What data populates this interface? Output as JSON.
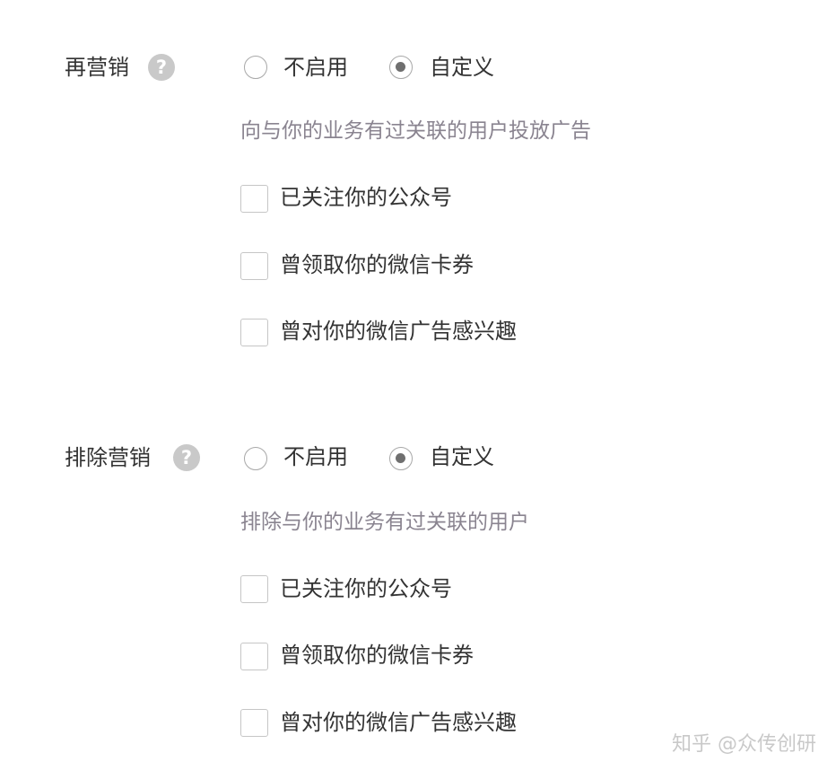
{
  "retargeting": {
    "label": "再营销",
    "help_icon": "question-mark-icon",
    "options": [
      {
        "label": "不启用",
        "selected": false
      },
      {
        "label": "自定义",
        "selected": true
      }
    ],
    "description": "向与你的业务有过关联的用户投放广告",
    "checkboxes": [
      {
        "label": "已关注你的公众号",
        "checked": false
      },
      {
        "label": "曾领取你的微信卡券",
        "checked": false
      },
      {
        "label": "曾对你的微信广告感兴趣",
        "checked": false
      }
    ]
  },
  "exclusion": {
    "label": "排除营销",
    "help_icon": "question-mark-icon",
    "options": [
      {
        "label": "不启用",
        "selected": false
      },
      {
        "label": "自定义",
        "selected": true
      }
    ],
    "description": "排除与你的业务有过关联的用户",
    "checkboxes": [
      {
        "label": "已关注你的公众号",
        "checked": false
      },
      {
        "label": "曾领取你的微信卡券",
        "checked": false
      },
      {
        "label": "曾对你的微信广告感兴趣",
        "checked": false
      }
    ]
  },
  "watermark": "知乎 @众传创研"
}
